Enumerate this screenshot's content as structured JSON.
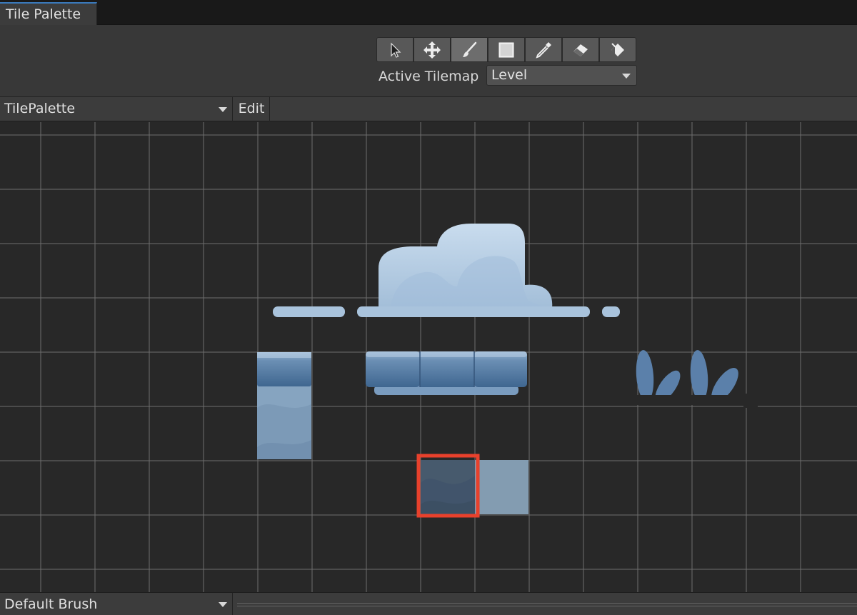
{
  "window": {
    "tab_title": "Tile Palette"
  },
  "toolbar": {
    "tools": [
      {
        "name": "select-tool",
        "icon": "arrow-cursor-icon",
        "active": false
      },
      {
        "name": "move-tool",
        "icon": "move-arrows-icon",
        "active": false
      },
      {
        "name": "paint-tool",
        "icon": "brush-icon",
        "active": true
      },
      {
        "name": "box-fill-tool",
        "icon": "rectangle-icon",
        "active": false
      },
      {
        "name": "picker-tool",
        "icon": "eyedropper-icon",
        "active": false
      },
      {
        "name": "erase-tool",
        "icon": "eraser-icon",
        "active": false
      },
      {
        "name": "fill-tool",
        "icon": "paint-bucket-icon",
        "active": false
      }
    ],
    "active_tilemap_label": "Active Tilemap",
    "active_tilemap_value": "Level"
  },
  "palette_bar": {
    "palette_value": "TilePalette",
    "edit_label": "Edit"
  },
  "bottom_bar": {
    "brush_value": "Default Brush"
  },
  "colors": {
    "background": "#282828",
    "grid_line": "#6e6e6e",
    "tile_light": "#a9c3dc",
    "tile_mid": "#5f86ad",
    "tile_dark": "#475a6d",
    "selection": "#e8412c"
  }
}
